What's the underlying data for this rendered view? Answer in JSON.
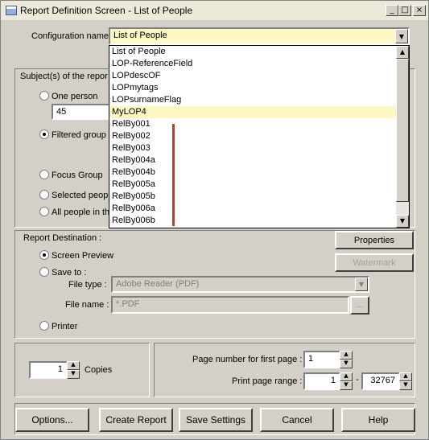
{
  "window": {
    "title": "Report Definition Screen - List of People",
    "controls": [
      "_",
      "□",
      "×"
    ]
  },
  "config": {
    "label": "Configuration name",
    "value": "List of People"
  },
  "dropdown": {
    "items": [
      "List of People",
      "LOP-ReferenceField",
      "LOPdescOF",
      "LOPmytags",
      "LOPsurnameFlag",
      "MyLOP4",
      "RelBy001",
      "RelBy002",
      "RelBy003",
      "RelBy004a",
      "RelBy004b",
      "RelBy005a",
      "RelBy005b",
      "RelBy006a",
      "RelBy006b"
    ],
    "highlighted_index": 5
  },
  "subjects": {
    "title": "Subject(s) of the repor",
    "one_person": "One person",
    "one_person_value": "45",
    "filtered_group": "Filtered group",
    "focus_group": "Focus Group",
    "selected_people": "Selected people",
    "all_people": "All people in the"
  },
  "destination": {
    "title": "Report Destination :",
    "screen_preview": "Screen Preview",
    "save_to": "Save to :",
    "file_type_label": "File type :",
    "file_type_value": "Adobe Reader (PDF)",
    "file_name_label": "File name :",
    "file_name_value": "*.PDF",
    "browse": "...",
    "printer": "Printer",
    "properties": "Properties",
    "watermark": "Watermark"
  },
  "copies": {
    "value": "1",
    "label": "Copies"
  },
  "pages": {
    "first_label": "Page number for first page :",
    "first_value": "1",
    "range_label": "Print page range :",
    "range_from": "1",
    "range_sep": "-",
    "range_to": "32767"
  },
  "buttons": {
    "options": "Options...",
    "create": "Create Report",
    "save": "Save Settings",
    "cancel": "Cancel",
    "help": "Help"
  }
}
